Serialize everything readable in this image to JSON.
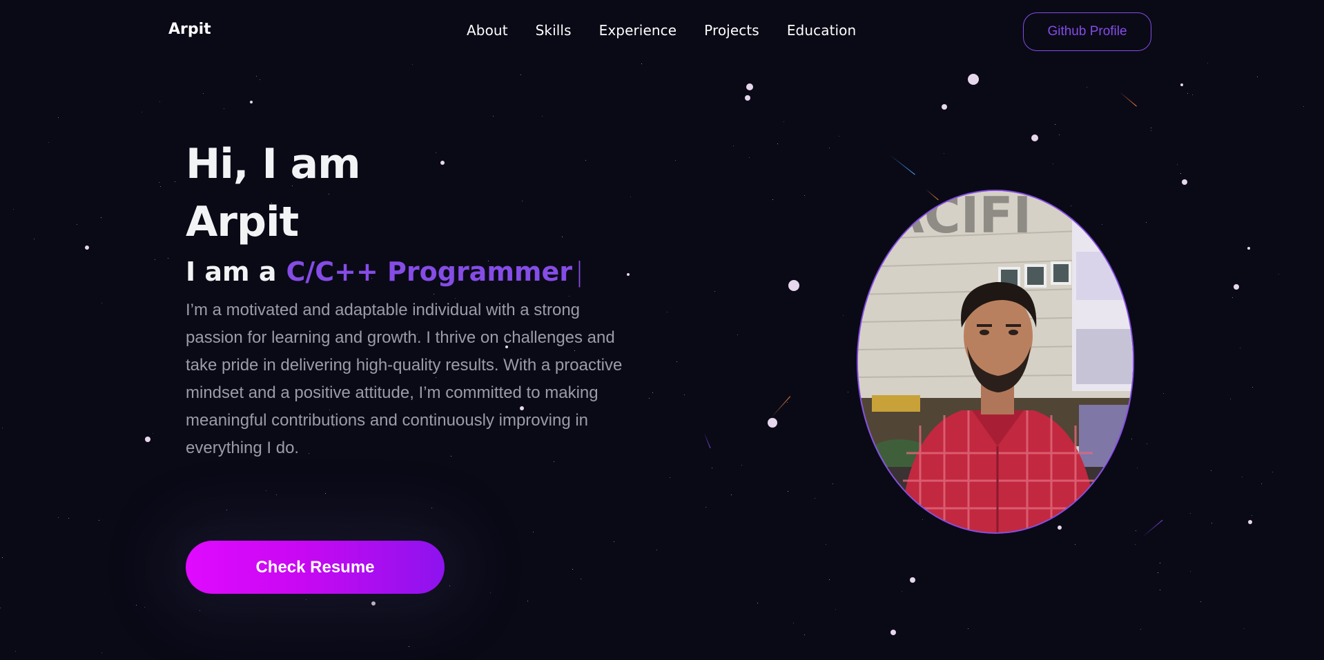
{
  "nav": {
    "logo": "Arpit",
    "links": [
      "About",
      "Skills",
      "Experience",
      "Projects",
      "Education"
    ],
    "github_label": "Github Profile"
  },
  "hero": {
    "title_line1": "Hi, I am",
    "title_line2": "Arpit",
    "role_prefix": "I am a",
    "role_typed": "C/C++ Programmer",
    "role_cursor": "|",
    "description": "I’m a motivated and adaptable individual with a strong passion for learning and growth. I thrive on challenges and take pride in delivering high-quality results. With a proactive mindset and a positive attitude, I’m committed to making meaningful contributions and continuously improving in everything I do.",
    "resume_label": "Check Resume",
    "photo_sign_text": "ACIFI"
  },
  "colors": {
    "background": "#0a0a17",
    "accent": "#854ce6",
    "text_primary": "#f2f3f4",
    "text_secondary": "#9b9ca6",
    "button_gradient_start": "#e00aff",
    "button_gradient_end": "#8d13ee"
  }
}
